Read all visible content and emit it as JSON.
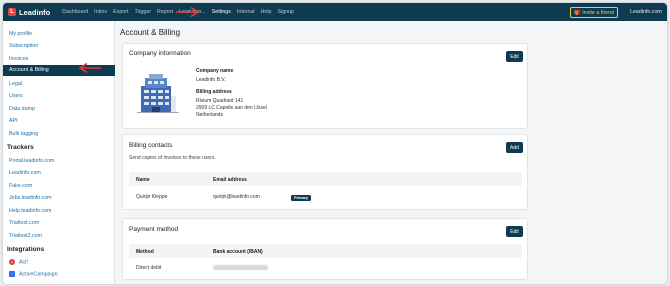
{
  "brand": {
    "name": "Leadinfo",
    "mark": "L"
  },
  "nav": {
    "items": [
      "Dashboard",
      "Inbox",
      "Export",
      "Trigger",
      "Report",
      "Lead Sco...",
      "Settings",
      "Internal",
      "Help",
      "Signup"
    ],
    "active": "Settings",
    "invite_label": "Invite a friend",
    "domain": "Leadinfo.com"
  },
  "sidebar": {
    "items": [
      "My profile",
      "Subscription",
      "Invoices",
      "Account & Billing",
      "Legal",
      "Users",
      "Data dump",
      "API",
      "Bulk tagging"
    ],
    "trackers_header": "Trackers",
    "trackers": [
      "Portal.leadinfo.com",
      "Leadinfo.com",
      "Fake.com",
      "Jobs.leadinfo.com",
      "Help.leadinfo.com",
      "Trialtest.com",
      "Trialtest2.com"
    ],
    "integrations_header": "Integrations",
    "integrations": [
      {
        "name": "Act!",
        "icon": "act-icon",
        "color": "#e53935"
      },
      {
        "name": "ActiveCampaign",
        "icon": "activecampaign-icon",
        "color": "#356ae6"
      }
    ]
  },
  "page": {
    "title": "Account & Billing"
  },
  "company_card": {
    "title": "Company information",
    "edit_label": "Edit",
    "name_label": "Company name",
    "name_value": "Leadinfo B.V.",
    "address_label": "Billing address",
    "address_lines": [
      "Rivium Quadrant 141",
      "2909 LC Capelle aan den IJssel",
      "Netherlands"
    ]
  },
  "contacts_card": {
    "title": "Billing contacts",
    "add_label": "Add",
    "subtitle": "Send copies of invoices to these users.",
    "headers": [
      "Name",
      "Email address"
    ],
    "rows": [
      {
        "name": "Quirijn Kleppe",
        "email": "quirijn@leadinfo.com",
        "badge": "Primary"
      }
    ]
  },
  "payment_card": {
    "title": "Payment method",
    "edit_label": "Edit",
    "headers": [
      "Method",
      "Bank account (IBAN)"
    ],
    "rows": [
      {
        "method": "Direct debit"
      }
    ]
  },
  "colors": {
    "navy": "#0e3b4f",
    "accent": "#f2c94c",
    "link": "#1f6fa8",
    "annotation": "#e53935"
  }
}
